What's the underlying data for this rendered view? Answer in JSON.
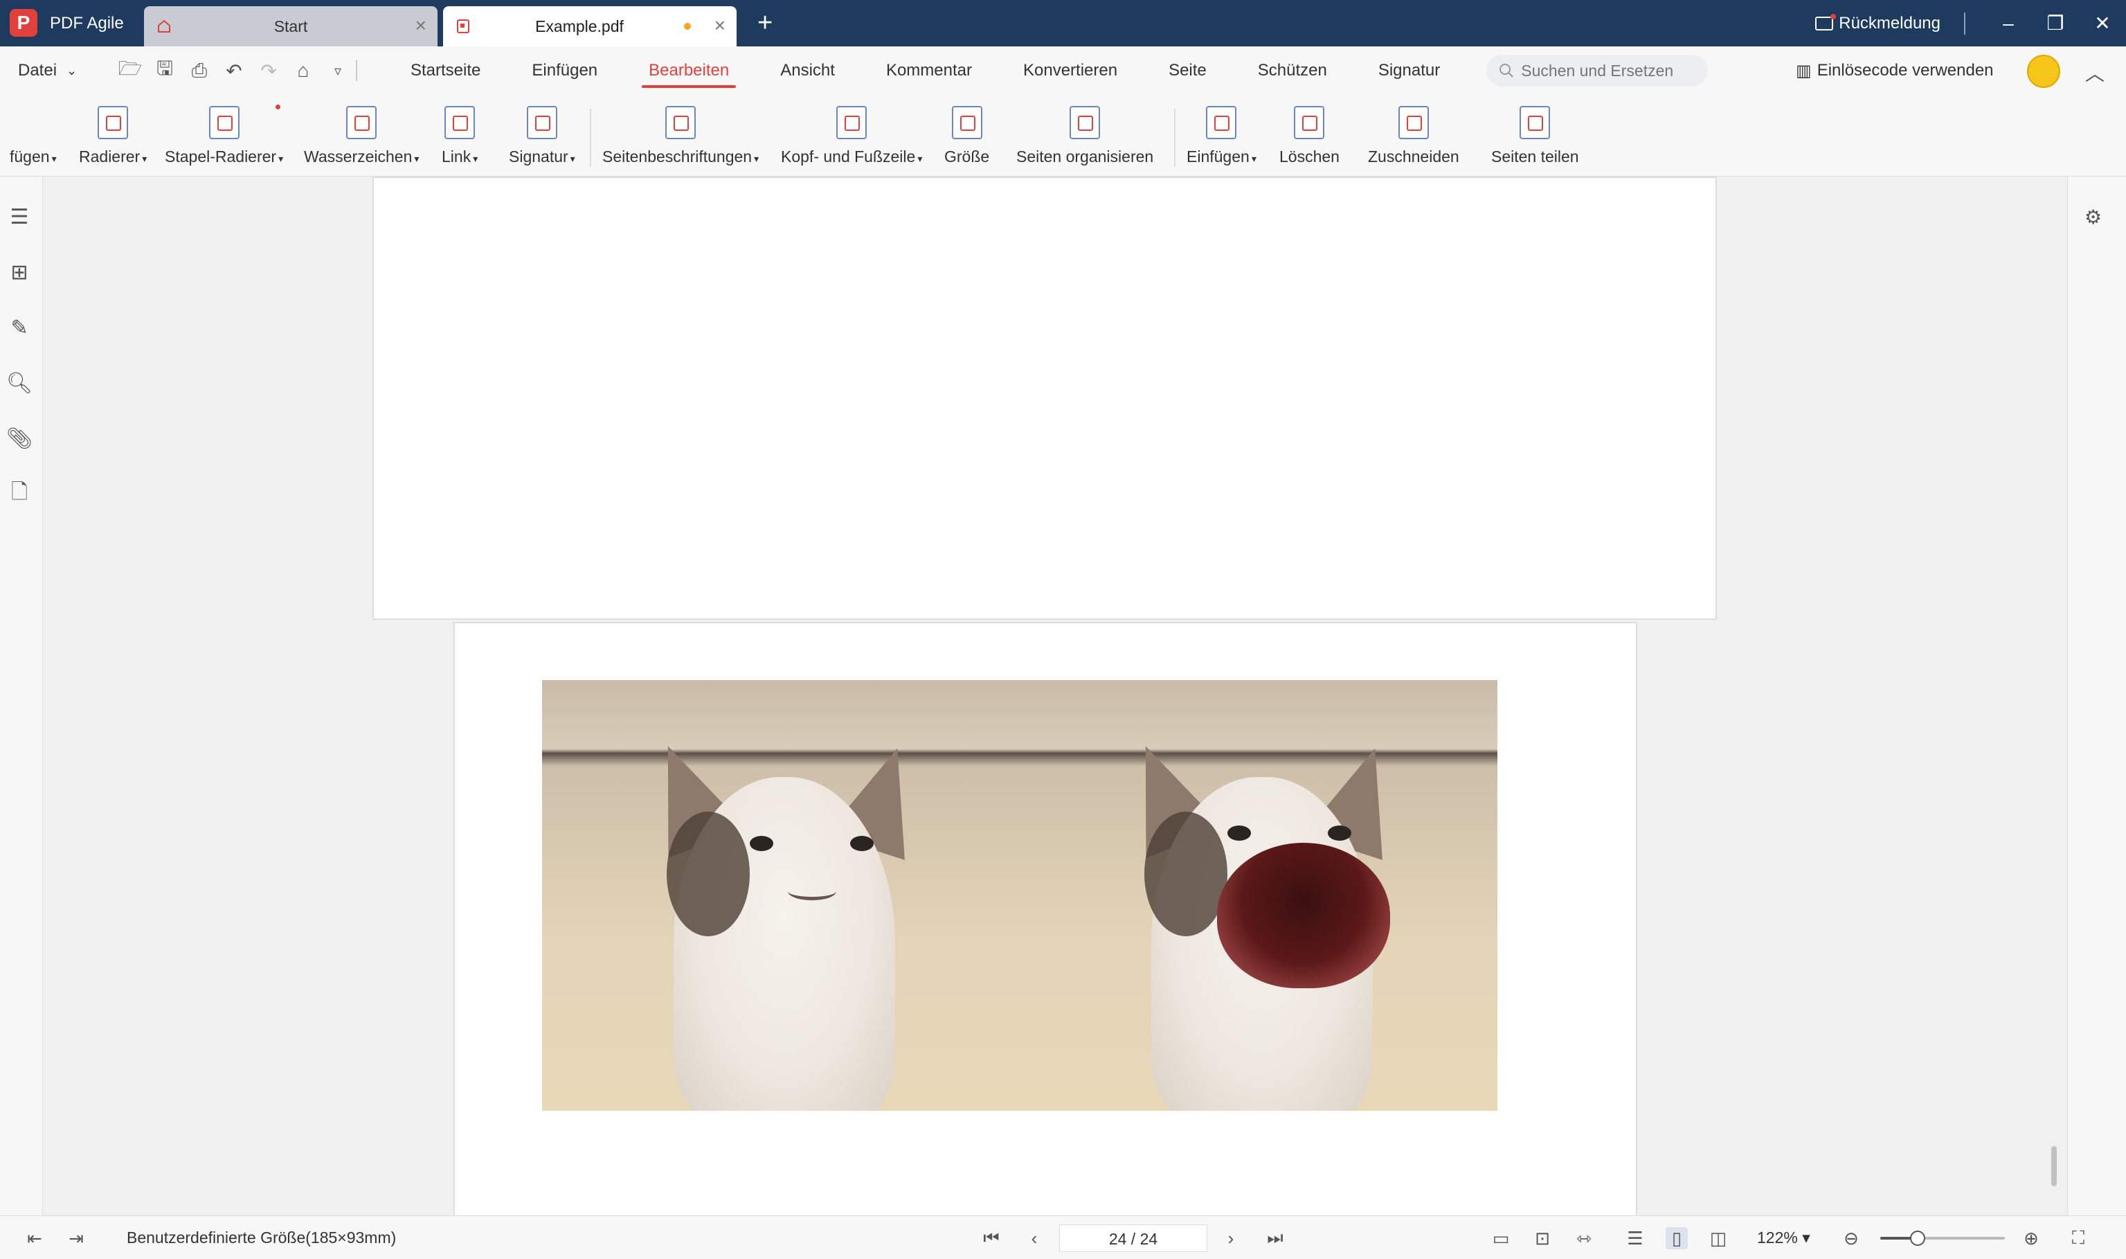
{
  "titlebar": {
    "app_name": "PDF Agile",
    "tabs": [
      {
        "label": "Start"
      },
      {
        "label": "Example.pdf"
      }
    ],
    "feedback": "Rückmeldung"
  },
  "menubar": {
    "file_menu": "Datei",
    "items": [
      "Startseite",
      "Einfügen",
      "Bearbeiten",
      "Ansicht",
      "Kommentar",
      "Konvertieren",
      "Seite",
      "Schützen",
      "Signatur"
    ],
    "active": "Bearbeiten",
    "search_placeholder": "Suchen und Ersetzen",
    "redeem": "Einlösecode verwenden"
  },
  "ribbon": {
    "items": [
      {
        "label": "fügen",
        "dropdown": true
      },
      {
        "label": "Radierer",
        "dropdown": true
      },
      {
        "label": "Stapel-Radierer",
        "dropdown": true
      },
      {
        "label": "Wasserzeichen",
        "dropdown": true
      },
      {
        "label": "Link",
        "dropdown": true
      },
      {
        "label": "Signatur",
        "dropdown": true
      },
      {
        "label": "Seitenbeschriftungen",
        "dropdown": true
      },
      {
        "label": "Kopf- und Fußzeile",
        "dropdown": true
      },
      {
        "label": "Größe",
        "dropdown": false
      },
      {
        "label": "Seiten organisieren",
        "dropdown": false
      },
      {
        "label": "Einfügen",
        "dropdown": true
      },
      {
        "label": "Löschen",
        "dropdown": false
      },
      {
        "label": "Zuschneiden",
        "dropdown": false
      },
      {
        "label": "Seiten teilen",
        "dropdown": false
      }
    ]
  },
  "statusbar": {
    "page_size": "Benutzerdefinierte Größe(185×93mm)",
    "page_indicator": "24 / 24",
    "zoom": "122%",
    "zoom_slider_fraction": 0.3
  }
}
